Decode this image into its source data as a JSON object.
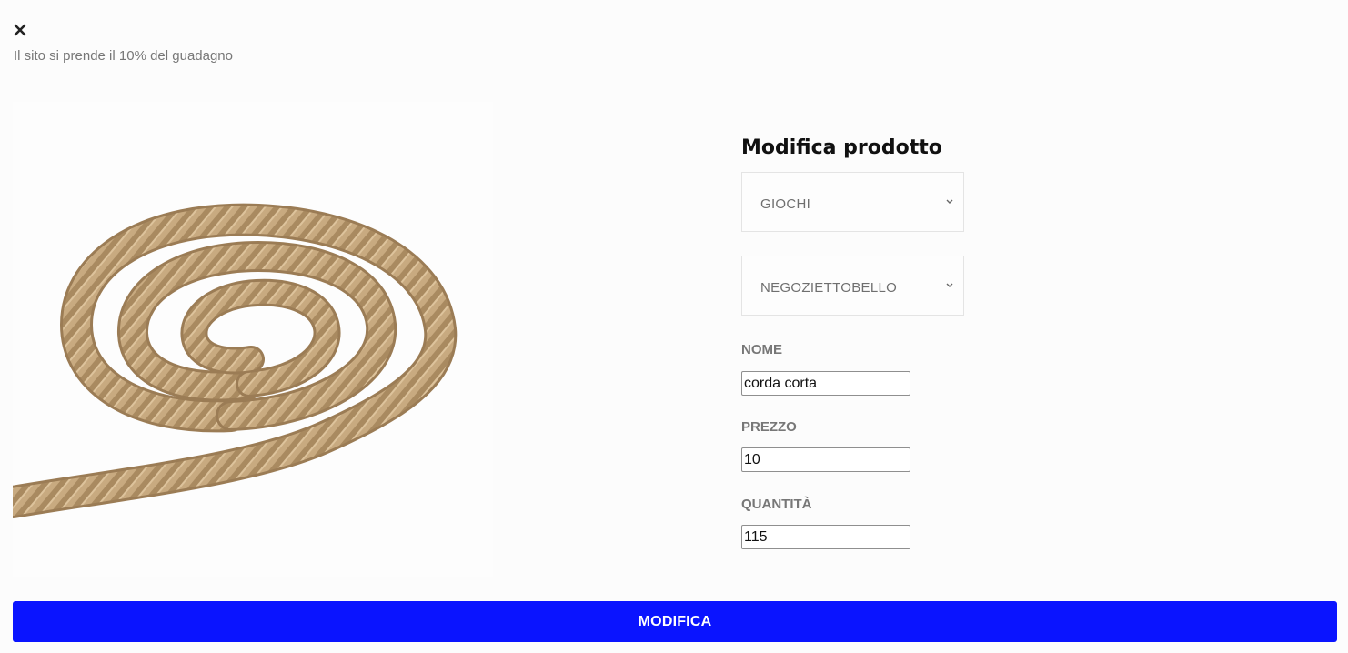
{
  "header": {
    "close_icon": "close-icon",
    "notice": "Il sito si prende il 10% del guadagno"
  },
  "product": {
    "image_subject": "rope-coil-image"
  },
  "form": {
    "title": "Modifica prodotto",
    "category_select": {
      "value": "GIOCHI",
      "icon": "chevron-down-icon"
    },
    "shop_select": {
      "value": "NEGOZIETTOBELLO",
      "icon": "chevron-down-icon"
    },
    "name": {
      "label": "NOME",
      "value": "corda corta"
    },
    "price": {
      "label": "PREZZO",
      "value": "10"
    },
    "quantity": {
      "label": "QUANTITÀ",
      "value": "115"
    },
    "submit_label": "MODIFICA"
  },
  "colors": {
    "accent": "#0a14ff",
    "background": "#fcfcfc",
    "label_text": "#777777"
  }
}
